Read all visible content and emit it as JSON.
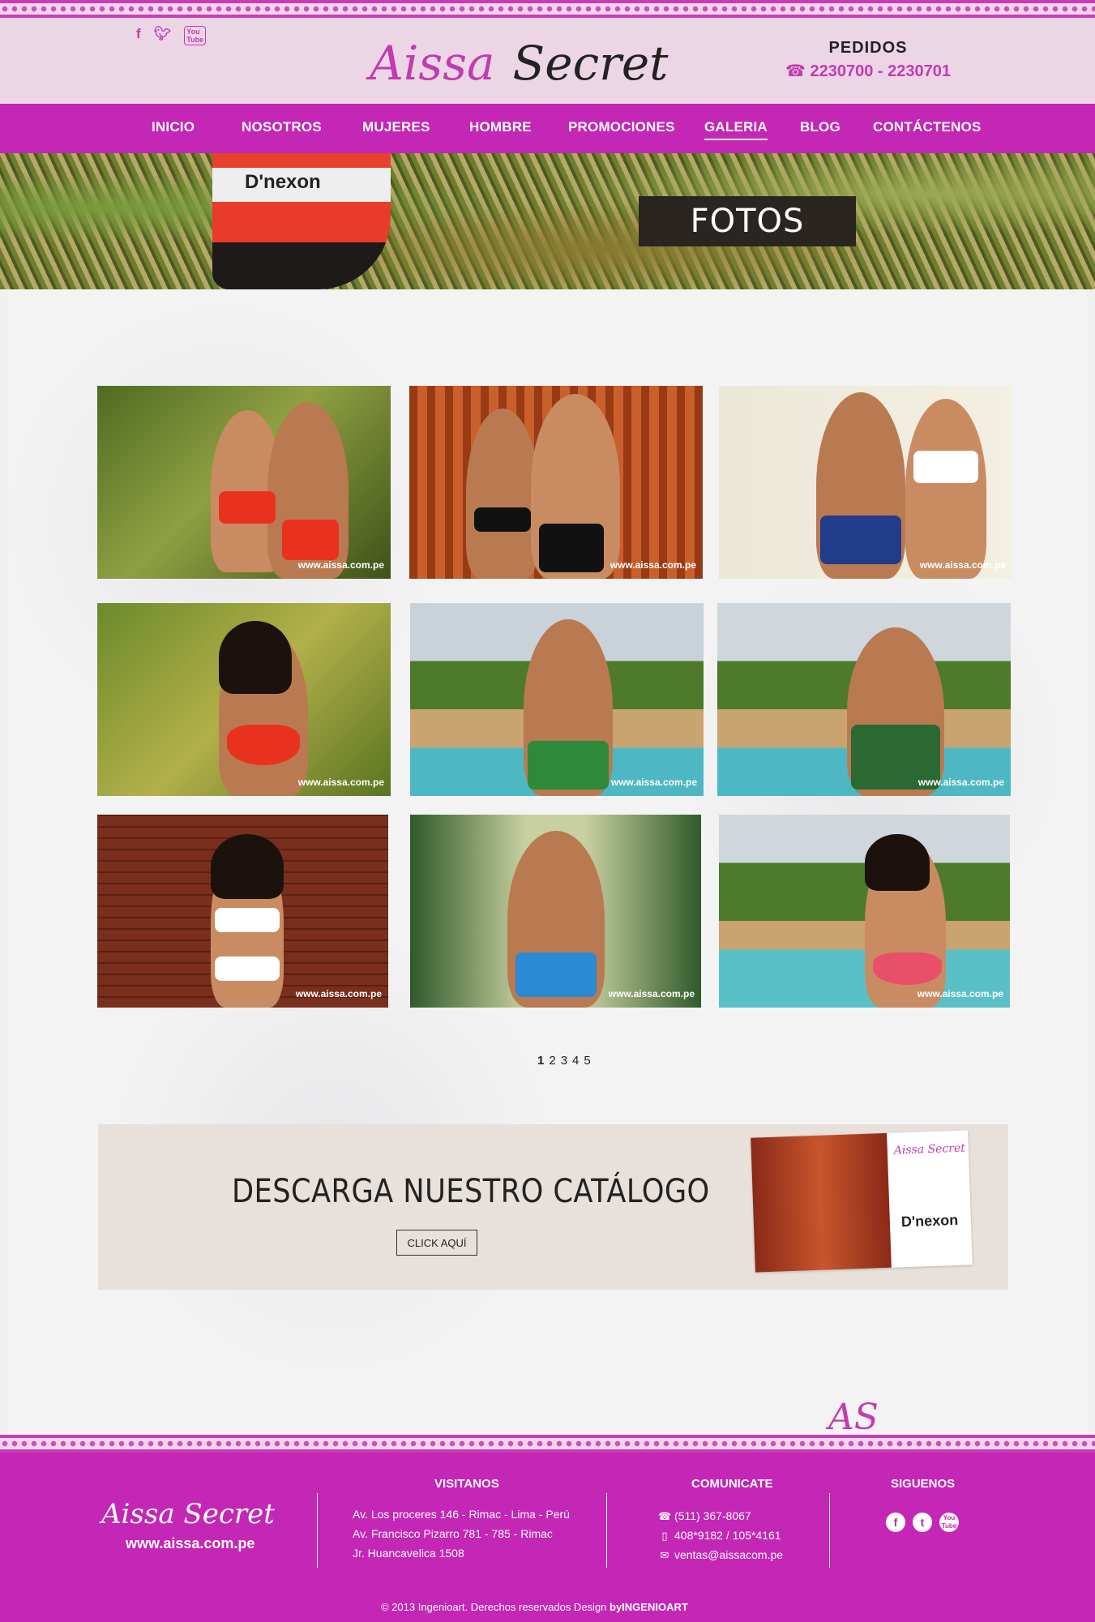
{
  "header": {
    "social": [
      "f",
      "t",
      "You\nTube"
    ],
    "logo_first": "Aissa",
    "logo_second": "Secret",
    "pedidos_title": "PEDIDOS",
    "pedidos_phones": "2230700 -  2230701"
  },
  "nav": {
    "items": [
      "INICIO",
      "NOSOTROS",
      "MUJERES",
      "HOMBRE",
      "PROMOCIONES",
      "GALERIA",
      "BLOG",
      "CONTÁCTENOS"
    ],
    "active": "GALERIA"
  },
  "banner": {
    "title": "FOTOS",
    "brand_text": "D'nexon"
  },
  "gallery": {
    "watermark": "www.aissa.com.pe",
    "pages": [
      "1",
      "2",
      "3",
      "4",
      "5"
    ]
  },
  "catalog": {
    "title": "DESCARGA NUESTRO CATÁLOGO",
    "button": "CLICK AQUÍ",
    "cover_logo": "Aissa Secret",
    "cover_brand": "D'nexon"
  },
  "footer": {
    "logo": "Aissa Secret",
    "url": "www.aissa.com.pe",
    "visitanos_title": "VISITANOS",
    "addresses": [
      "Av. Los proceres 146 - Rimac - Lima - Perú",
      "Av. Francisco Pizarro 781 - 785 - Rimac",
      "Jr. Huancavelica 1508"
    ],
    "comunicate_title": "COMUNICATE",
    "phone": "(511) 367-8067",
    "mobile": "408*9182 / 105*4161",
    "email": "ventas@aissacom.pe",
    "siguenos_title": "SIGUENOS",
    "copyright": "© 2013 Ingenioart. Derechos reservados Design ",
    "copyright_strong": "byINGENIOART"
  },
  "colors": {
    "brand_magenta": "#c426b6",
    "header_pink": "#ecd6e6",
    "catalog_bg": "#e8e0da"
  }
}
